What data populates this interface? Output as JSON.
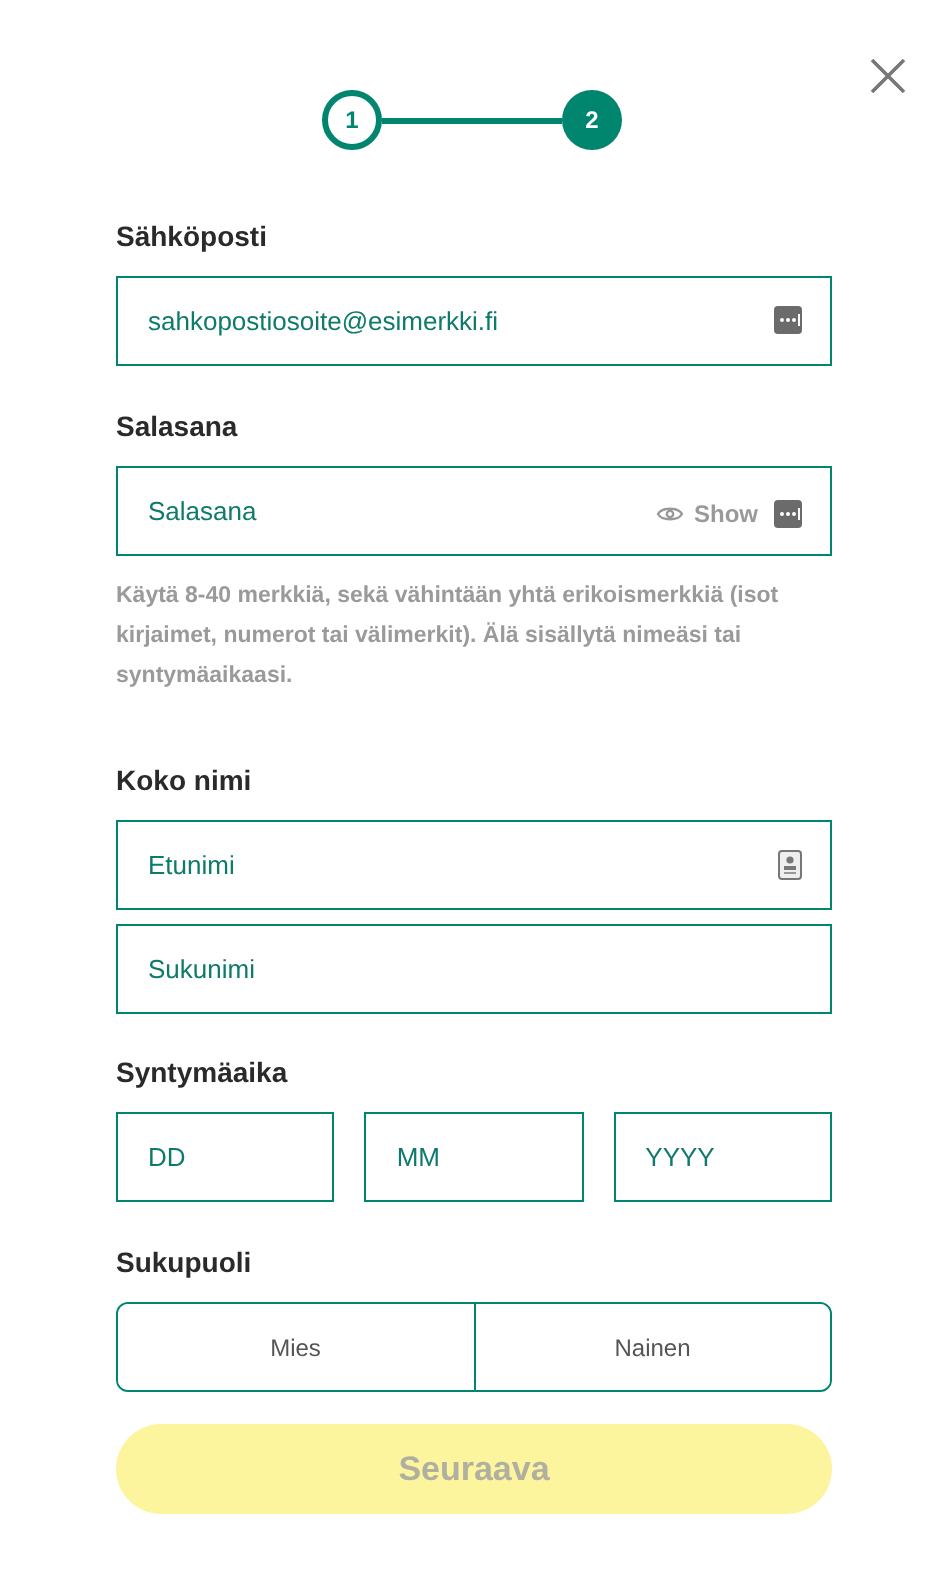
{
  "steps": [
    {
      "label": "1",
      "selected": false
    },
    {
      "label": "2",
      "selected": true
    }
  ],
  "email": {
    "label": "Sähköposti",
    "placeholder": "sahkopostiosoite@esimerkki.fi"
  },
  "password": {
    "label": "Salasana",
    "placeholder": "Salasana",
    "toggle": "Show",
    "hint": "Käytä 8-40 merkkiä, sekä vähintään yhtä erikoismerkkiä (isot kirjaimet, numerot tai välimerkit). Älä sisällytä nimeäsi tai syntymäaikaasi."
  },
  "name": {
    "label": "Koko nimi",
    "first_placeholder": "Etunimi",
    "last_placeholder": "Sukunimi"
  },
  "birthdate": {
    "label": "Syntymäaika",
    "fields": [
      {
        "placeholder": "DD"
      },
      {
        "placeholder": "MM"
      },
      {
        "placeholder": "YYYY"
      }
    ]
  },
  "gender": {
    "label": "Sukupuoli",
    "options": [
      {
        "label": "Mies",
        "selected": false
      },
      {
        "label": "Nainen",
        "selected": false
      }
    ]
  },
  "next_button": {
    "label": "Seuraava",
    "disabled": true
  }
}
